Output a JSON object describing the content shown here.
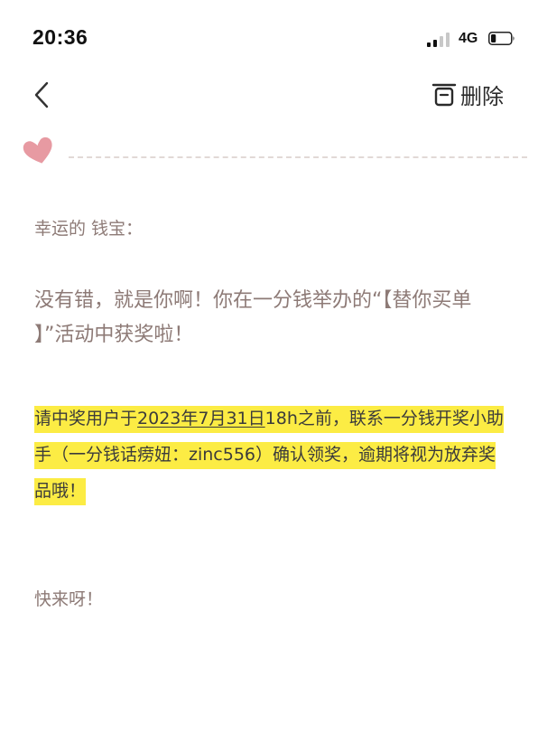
{
  "status_bar": {
    "time": "20:36",
    "network": "4G",
    "signal_bars_active": 2,
    "signal_bars_total": 4,
    "battery_level": 0.25
  },
  "header": {
    "back_icon": "chevron-left-icon",
    "delete_icon": "trash-icon",
    "delete_label": "删除"
  },
  "decoration": {
    "heart_icon": "heart-icon",
    "heart_color": "#e79aa2"
  },
  "letter": {
    "greeting": "幸运的 钱宝：",
    "message": "没有错，就是你啊！你在一分钱举办的“【替你买单 】”活动中获奖啦！",
    "notice_before": "请中奖用户于",
    "notice_date": "2023年7月31日",
    "notice_after": "18h之前，联系一分钱开奖小助手（一分钱话痨妞：zinc556）确认领奖，逾期将视为放弃奖品哦！",
    "closing": "快来呀！"
  },
  "colors": {
    "text": "#8d7a76",
    "highlight": "#fcec44",
    "notice_text": "#3b3b3b"
  }
}
